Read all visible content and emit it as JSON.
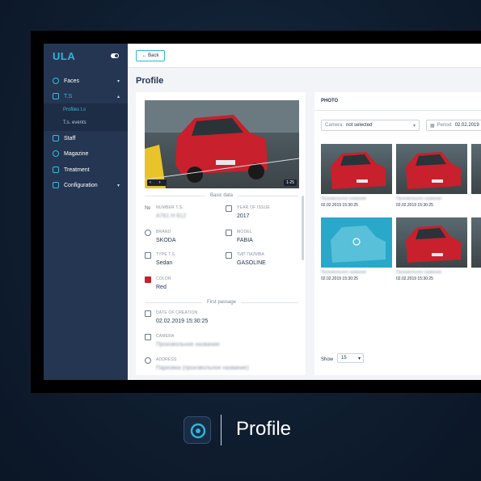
{
  "app": {
    "logo": "ULA"
  },
  "sidebar": {
    "items": [
      {
        "label": "Faces",
        "chevron": "▾"
      },
      {
        "label": "T.S",
        "chevron": "▴"
      },
      {
        "label": "Staff"
      },
      {
        "label": "Magazine"
      },
      {
        "label": "Treatment"
      },
      {
        "label": "Configuration",
        "chevron": "▾"
      }
    ],
    "submenu": [
      "Profiles t.s",
      "T.s. events"
    ]
  },
  "topbar": {
    "back_label": "← Back"
  },
  "page": {
    "title": "Profile"
  },
  "profile": {
    "image_counter": "1-25",
    "basic_section": "Basic data",
    "number_label": "NUMBER T.S.",
    "number_value": "A761 H 812",
    "year_label": "YEAR OF ISSUE",
    "year_value": "2017",
    "brand_label": "BRAND",
    "brand_value": "SKODA",
    "model_label": "MODEL",
    "model_value": "FABIA",
    "type_label": "TYPE T.S.",
    "type_value": "Sedan",
    "fuel_label": "ТИП ПАЛИВА",
    "fuel_value": "GASOLINE",
    "color_label": "COLOR",
    "color_value": "Red",
    "passage_section": "First passage",
    "date_label": "DATE OF CREATION",
    "date_value": "02.02.2019 15:30:25",
    "camera_label": "CAMERA",
    "camera_value": "Произвольное название",
    "address_label": "ADDRESS",
    "address_value": "Парковка (произвольное название)"
  },
  "photo": {
    "title": "PHOTO",
    "camera_label": "Camera:",
    "camera_value": "not selected",
    "period_label": "Period:",
    "period_value": "02.02.2019",
    "thumbs": [
      {
        "name": "Произвольное название",
        "date": "02.02.2019 15:30:25"
      },
      {
        "name": "Произвольное название",
        "date": "02.02.2019 15:30:25"
      },
      {
        "name": "Произвольное название",
        "date": "02.02.2019 15:30:25"
      },
      {
        "name": "Произвольное название",
        "date": "02.02.2019 15:30:25"
      }
    ],
    "show_label": "Show",
    "show_value": "15"
  },
  "brand": {
    "title": "Profile"
  },
  "colors": {
    "accent": "#2fb4d8",
    "sidebar": "#253652",
    "car": "#c8202c"
  }
}
